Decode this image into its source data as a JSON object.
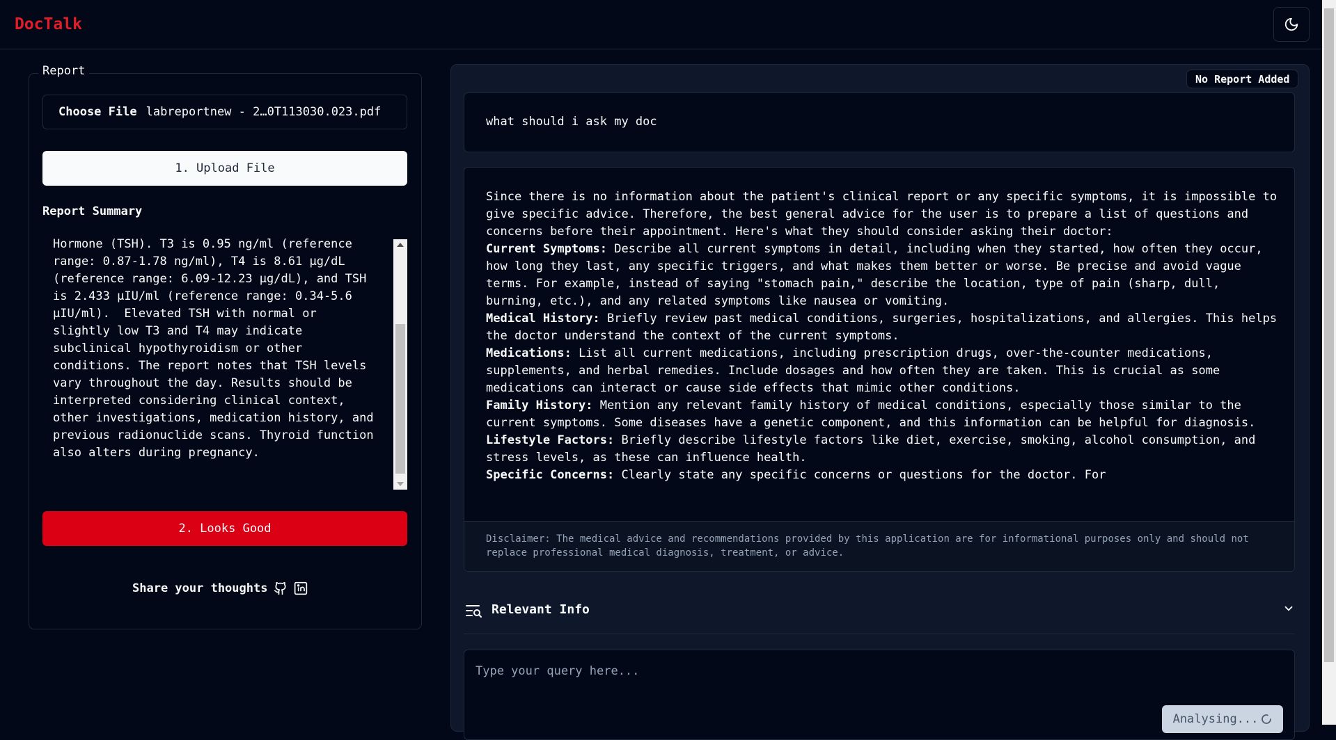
{
  "app": {
    "brand": "DocTalk"
  },
  "header": {
    "theme_icon": "moon-icon"
  },
  "report": {
    "legend": "Report",
    "file_button": "Choose File",
    "file_name": "labreportnew - 2…0T113030.023.pdf",
    "upload_label": "1. Upload File",
    "summary_label": "Report Summary",
    "summary_text": "Hormone (TSH). T3 is 0.95 ng/ml (reference\nrange: 0.87-1.78 ng/ml), T4 is 8.61 µg/dL\n(reference range: 6.09-12.23 µg/dL), and TSH\nis 2.433 µIU/ml (reference range: 0.34-5.6\nµIU/ml).  Elevated TSH with normal or\nslightly low T3 and T4 may indicate\nsubclinical hypothyroidism or other\nconditions. The report notes that TSH levels\nvary throughout the day. Results should be\ninterpreted considering clinical context,\nother investigations, medication history, and\nprevious radionuclide scans. Thyroid function\nalso alters during pregnancy.",
    "confirm_label": "2. Looks Good",
    "share_label": "Share your thoughts"
  },
  "chat": {
    "badge": "No Report Added",
    "query": "what should i ask my doc",
    "answer_intro": "Since there is no information about the patient's clinical report or any specific symptoms, it is impossible to give specific advice. Therefore, the best general advice for the user is to prepare a list of questions and concerns before their appointment. Here's what they should consider asking their doctor:",
    "sections": [
      {
        "title": "Current Symptoms:",
        "text": " Describe all current symptoms in detail, including when they started, how often they occur, how long they last, any specific triggers, and what makes them better or worse. Be precise and avoid vague terms. For example, instead of saying \"stomach pain,\" describe the location, type of pain (sharp, dull, burning, etc.), and any related symptoms like nausea or vomiting."
      },
      {
        "title": "Medical History:",
        "text": " Briefly review past medical conditions, surgeries, hospitalizations, and allergies. This helps the doctor understand the context of the current symptoms."
      },
      {
        "title": "Medications:",
        "text": " List all current medications, including prescription drugs, over-the-counter medications, supplements, and herbal remedies. Include dosages and how often they are taken. This is crucial as some medications can interact or cause side effects that mimic other conditions."
      },
      {
        "title": "Family History:",
        "text": " Mention any relevant family history of medical conditions, especially those similar to the current symptoms. Some diseases have a genetic component, and this information can be helpful for diagnosis."
      },
      {
        "title": "Lifestyle Factors:",
        "text": " Briefly describe lifestyle factors like diet, exercise, smoking, alcohol consumption, and stress levels, as these can influence health."
      },
      {
        "title": "Specific Concerns:",
        "text": " Clearly state any specific concerns or questions for the doctor. For"
      }
    ],
    "disclaimer": "Disclaimer: The medical advice and recommendations provided by this application are for informational purposes only and should not replace professional medical diagnosis, treatment, or advice.",
    "relevant_label": "Relevant Info",
    "input_placeholder": "Type your query here...",
    "analysing_label": "Analysing..."
  }
}
